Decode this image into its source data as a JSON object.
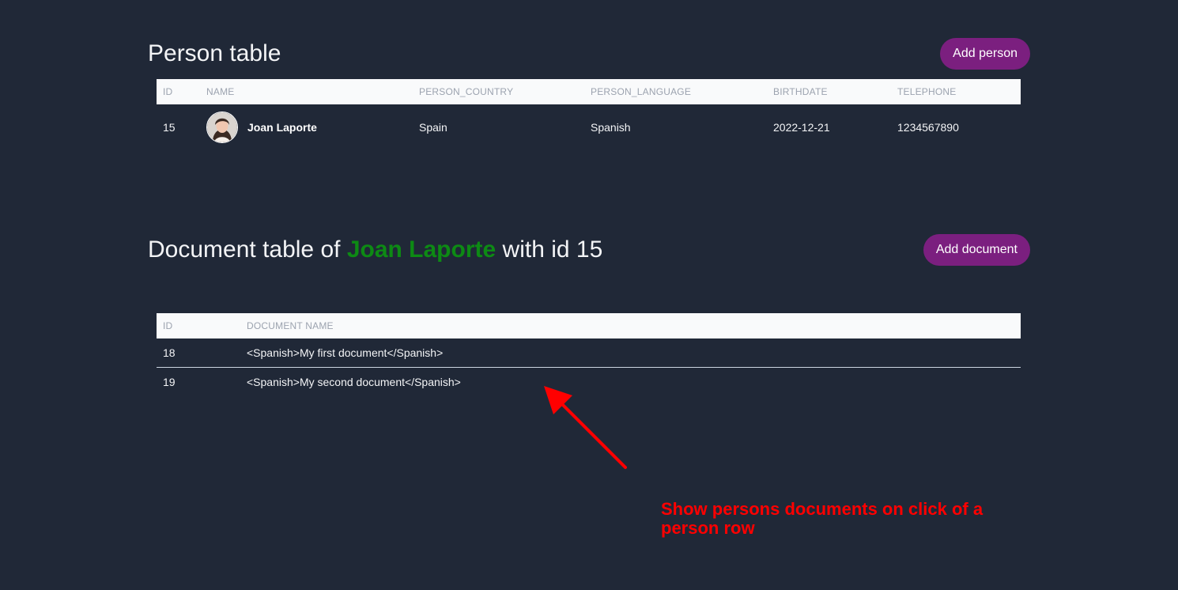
{
  "person_section": {
    "title": "Person table",
    "add_button": "Add person",
    "columns": [
      "ID",
      "NAME",
      "PERSON_COUNTRY",
      "PERSON_LANGUAGE",
      "BIRTHDATE",
      "TELEPHONE"
    ],
    "rows": [
      {
        "id": "15",
        "name": "Joan Laporte",
        "country": "Spain",
        "language": "Spanish",
        "birthdate": "2022-12-21",
        "telephone": "1234567890"
      }
    ]
  },
  "document_section": {
    "title_prefix": "Document table of ",
    "person_name": "Joan Laporte",
    "title_suffix": " with id 15",
    "add_button": "Add document",
    "columns": [
      "ID",
      "DOCUMENT NAME"
    ],
    "rows": [
      {
        "id": "18",
        "name": "<Spanish>My first document</Spanish>"
      },
      {
        "id": "19",
        "name": "<Spanish>My second document</Spanish>"
      }
    ]
  },
  "annotation": {
    "text": "Show persons documents on click of a person row",
    "color": "#ff0000"
  },
  "colors": {
    "background": "#202837",
    "button": "#7b1f7f",
    "highlight_name": "#0d8a14",
    "green_text": "#22c55e",
    "header_row": "#f9fafb"
  },
  "icons": {
    "avatar": "avatar-photo",
    "arrow": "arrow-icon"
  }
}
